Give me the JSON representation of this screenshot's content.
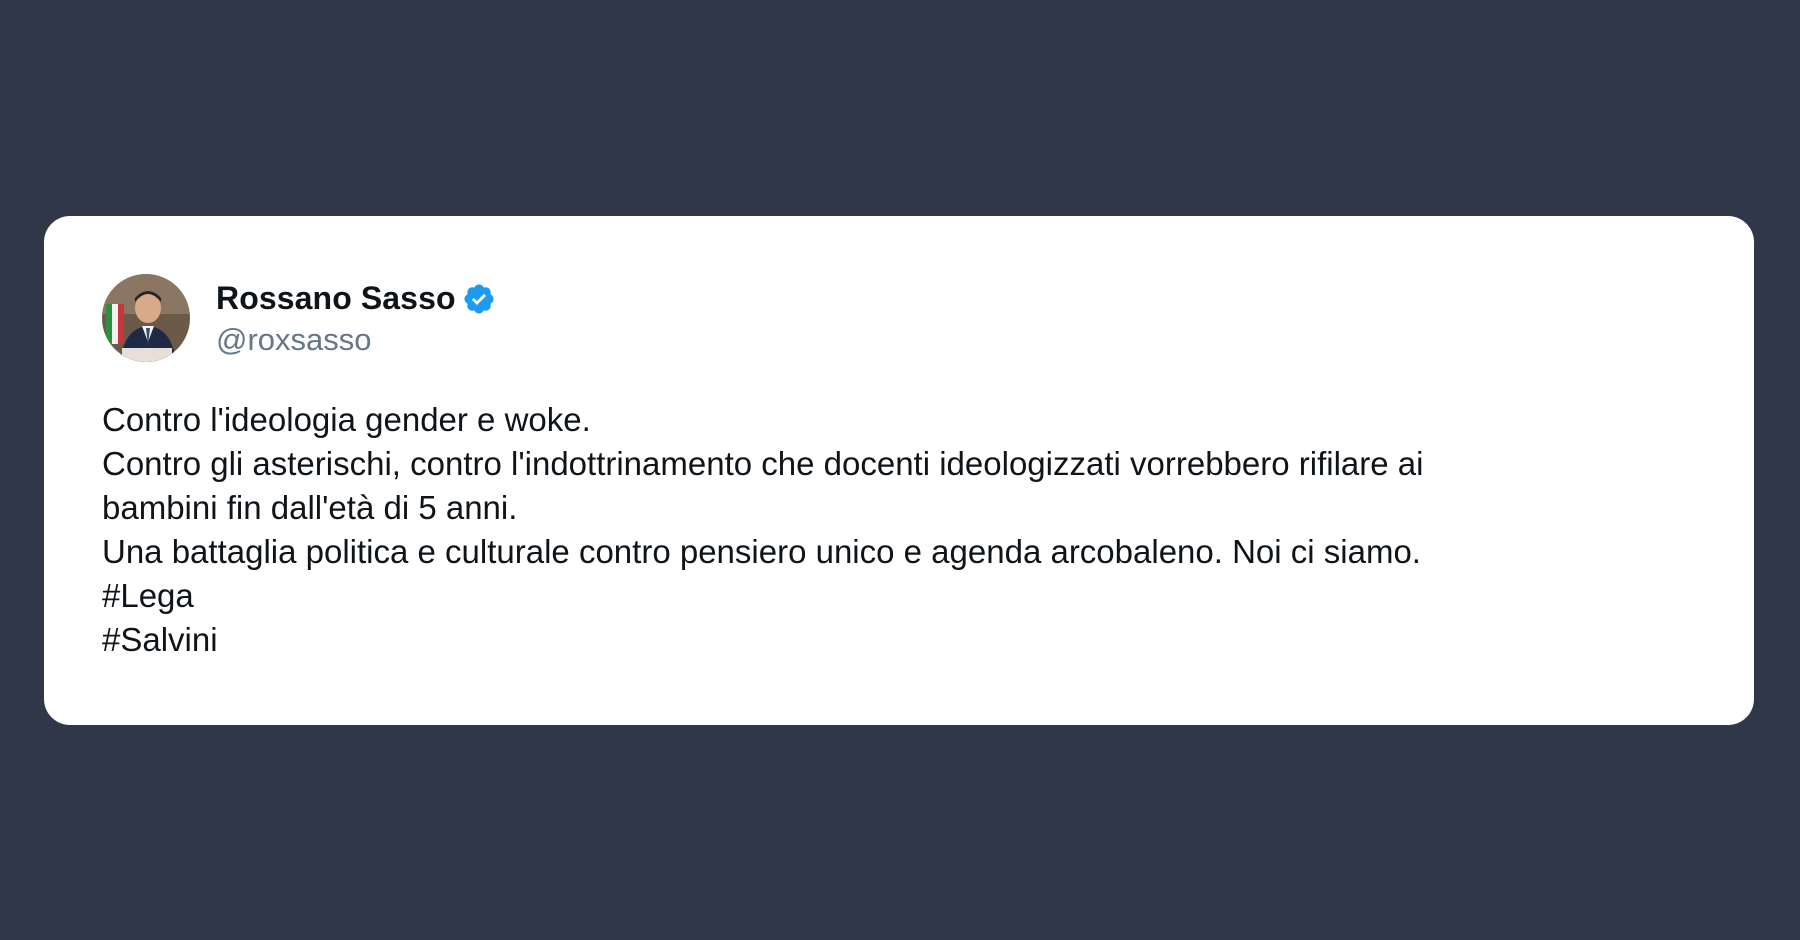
{
  "tweet": {
    "author": {
      "display_name": "Rossano Sasso",
      "handle": "@roxsasso",
      "verified": true,
      "verified_color": "#1d9bf0"
    },
    "lines": [
      "Contro l'ideologia gender e woke.",
      "Contro gli asterischi, contro l'indottrinamento che docenti ideologizzati vorrebbero rifilare ai",
      "bambini fin dall'età di 5 anni.",
      "Una battaglia politica e culturale contro pensiero unico e agenda arcobaleno. Noi ci siamo.",
      "#Lega",
      "#Salvini"
    ]
  },
  "colors": {
    "background": "#2f3748",
    "card": "#ffffff",
    "text": "#0f1419",
    "handle": "#66778a"
  }
}
